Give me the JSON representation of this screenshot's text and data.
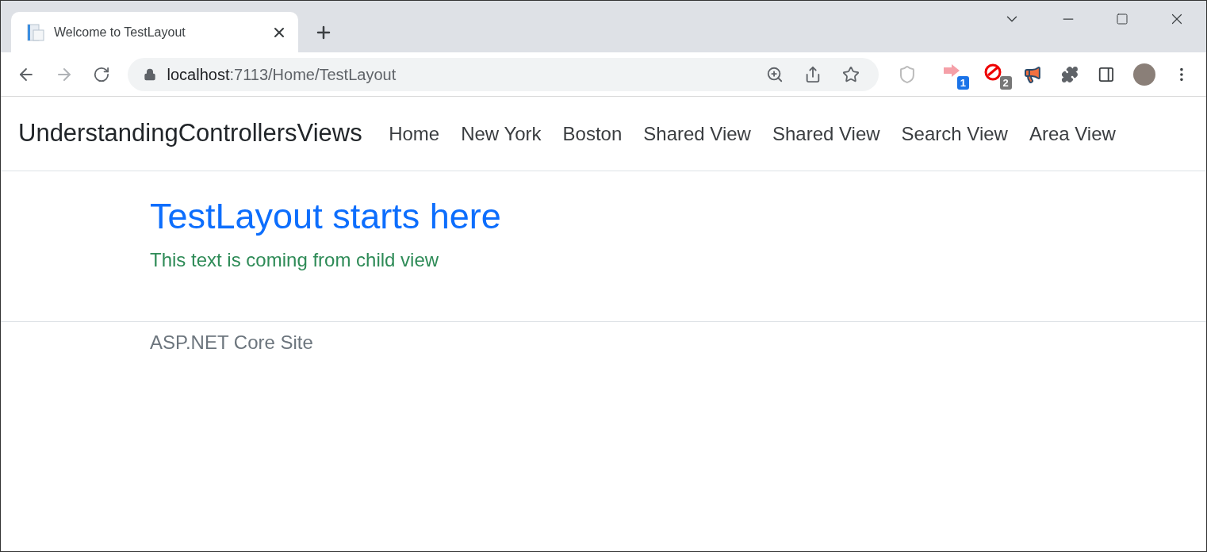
{
  "browser": {
    "tab": {
      "title": "Welcome to TestLayout",
      "selected": true
    },
    "address": {
      "host": "localhost",
      "path": ":7113/Home/TestLayout"
    },
    "extension_badges": [
      "1",
      "2"
    ]
  },
  "navbar": {
    "brand": "UnderstandingControllersViews",
    "links": [
      {
        "label": "Home"
      },
      {
        "label": "New York"
      },
      {
        "label": "Boston"
      },
      {
        "label": "Shared View"
      },
      {
        "label": "Shared View"
      },
      {
        "label": "Search View"
      },
      {
        "label": "Area View"
      }
    ]
  },
  "main": {
    "heading": "TestLayout starts here",
    "text": "This text is coming from child view"
  },
  "footer": {
    "text": "ASP.NET Core Site"
  }
}
